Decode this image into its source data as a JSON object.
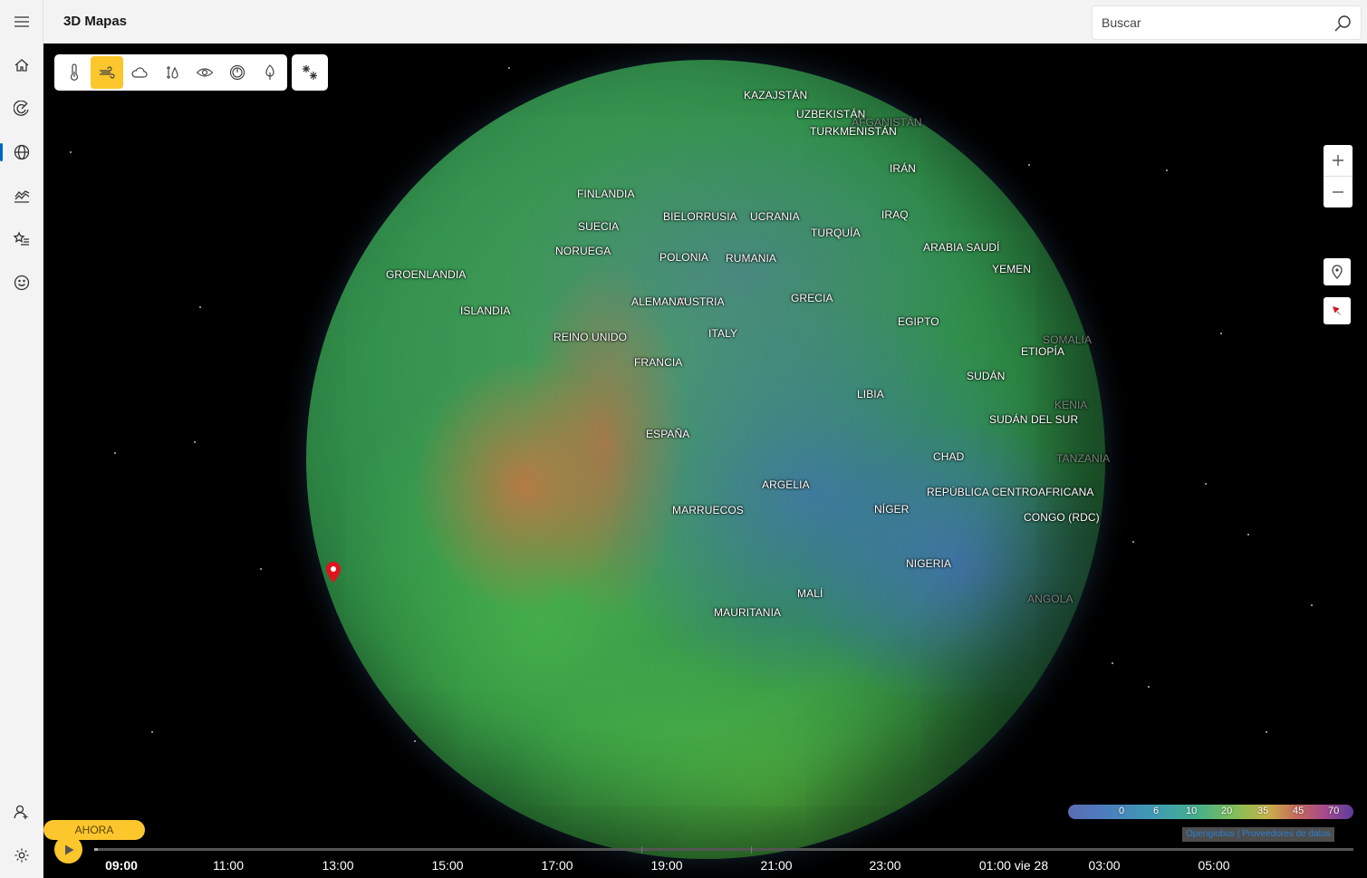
{
  "app": {
    "title": "3D Mapas"
  },
  "search": {
    "placeholder": "Buscar"
  },
  "nav": {
    "items": [
      {
        "name": "hamburger-menu-icon"
      },
      {
        "name": "home-icon"
      },
      {
        "name": "radar-icon"
      },
      {
        "name": "globe-icon",
        "active": true
      },
      {
        "name": "chart-icon"
      },
      {
        "name": "favorites-icon"
      },
      {
        "name": "smiley-icon"
      },
      {
        "name": "add-user-icon"
      },
      {
        "name": "settings-icon"
      }
    ]
  },
  "layers": {
    "items": [
      {
        "name": "temperature-icon"
      },
      {
        "name": "wind-icon",
        "selected": true
      },
      {
        "name": "cloud-icon"
      },
      {
        "name": "humidity-icon"
      },
      {
        "name": "visibility-icon"
      },
      {
        "name": "pressure-icon"
      },
      {
        "name": "pollen-icon"
      }
    ],
    "extra": "snow-icon",
    "accent_color": "#fcc72c"
  },
  "map": {
    "countries": [
      "KAZAJSTÁN",
      "UZBEKISTÁN",
      "AFGANISTÁN",
      "TURKMENISTÁN",
      "IRÁN",
      "FINLANDIA",
      "SUECIA",
      "BIELORRUSIA",
      "UCRANIA",
      "IRAQ",
      "NORUEGA",
      "TURQUÍA",
      "POLONIA",
      "RUMANIA",
      "ARABIA SAUDÍ",
      "GROENLANDIA",
      "YEMEN",
      "ISLANDIA",
      "ALEMANIA",
      "AUSTRIA",
      "GRECIA",
      "EGIPTO",
      "REINO UNIDO",
      "ITALY",
      "SOMALIA",
      "ETIOPÍA",
      "FRANCIA",
      "SUDÁN",
      "LIBIA",
      "KENIA",
      "SUDÁN DEL SUR",
      "ESPAÑA",
      "CHAD",
      "TANZANIA",
      "ARGELIA",
      "REPÚBLICA CENTROAFRICANA",
      "MARRUECOS",
      "NÍGER",
      "CONGO (RDC)",
      "NIGERIA",
      "MALÍ",
      "ANGOLA",
      "MAURITANIA"
    ],
    "pin_color": "#e0141e"
  },
  "controls": {
    "zoom_in": "plus-icon",
    "zoom_out": "minus-icon",
    "location": "location-pin-icon",
    "compass": "compass-icon"
  },
  "legend": {
    "values": [
      "0",
      "6",
      "10",
      "20",
      "35",
      "45",
      "70"
    ],
    "credits": "Opengiobus | Proveedores de datos"
  },
  "timeline": {
    "now_label": "AHORA",
    "current": "09:00",
    "labels": [
      "09:00",
      "11:00",
      "13:00",
      "15:00",
      "17:00",
      "19:00",
      "21:00",
      "23:00",
      "01:00 vie 28",
      "03:00",
      "05:00"
    ]
  }
}
